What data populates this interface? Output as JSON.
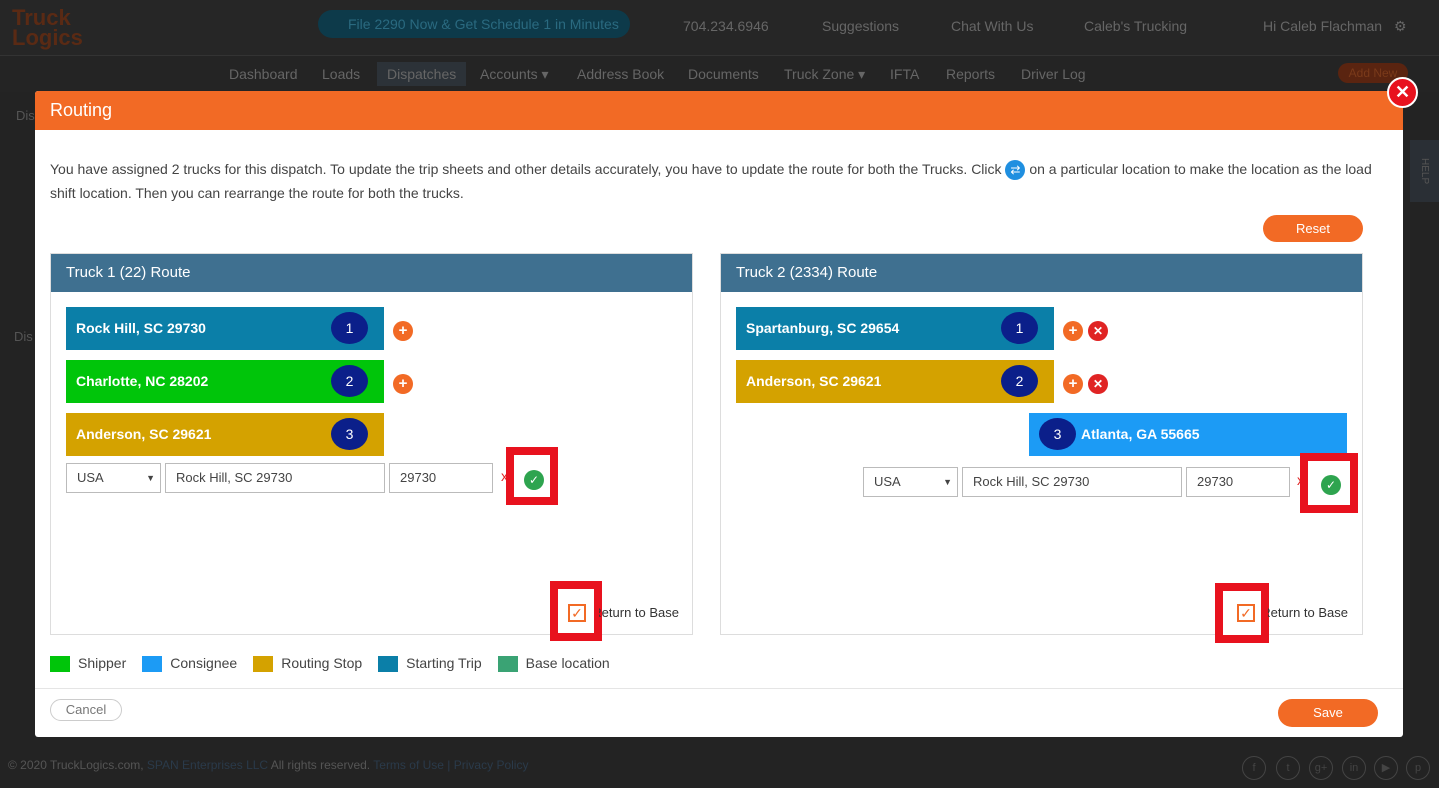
{
  "header": {
    "logo": "Truck Logics",
    "promo": "File 2290 Now & Get Schedule 1 in Minutes",
    "phone": "704.234.6946",
    "suggestions": "Suggestions",
    "chat": "Chat With Us",
    "company": "Caleb's Trucking",
    "user": "Hi Caleb Flachman"
  },
  "nav": {
    "items": [
      "Dashboard",
      "Loads",
      "Dispatches",
      "Accounts ▾",
      "Address Book",
      "Documents",
      "Truck Zone ▾",
      "IFTA",
      "Reports",
      "Driver Log"
    ],
    "add_new": "Add New"
  },
  "sidebar": {
    "top": "Dis",
    "bottom": "Dis"
  },
  "help": "HELP",
  "footer": {
    "copyright": "© 2020 TruckLogics.com,",
    "company": "SPAN Enterprises LLC",
    "rights": "All rights reserved.",
    "terms": "Terms of Use",
    "sep": "|",
    "privacy": "Privacy Policy"
  },
  "modal": {
    "title": "Routing",
    "intro_before": "You have assigned 2 trucks for this dispatch. To update the trip sheets and other details accurately, you have to update the route for both the Trucks. Click",
    "intro_after": "on a particular location to make the location as the load shift location. Then you can rearrange the route for both the trucks.",
    "reset": "Reset",
    "truck1": {
      "title": "Truck 1 (22) Route",
      "stops": [
        {
          "label": "Rock Hill, SC 29730",
          "num": "1",
          "type": "Starting Trip"
        },
        {
          "label": "Charlotte, NC 28202",
          "num": "2",
          "type": "Shipper"
        },
        {
          "label": "Anderson, SC 29621",
          "num": "3",
          "type": "Routing Stop"
        }
      ],
      "country": "USA",
      "address": "Rock Hill, SC 29730",
      "zip": "29730",
      "return_to_base": "Return to Base",
      "return_checked": true
    },
    "truck2": {
      "title": "Truck 2 (2334) Route",
      "stops": [
        {
          "label": "Spartanburg, SC 29654",
          "num": "1",
          "type": "Starting Trip"
        },
        {
          "label": "Anderson, SC 29621",
          "num": "2",
          "type": "Routing Stop"
        },
        {
          "label": "Atlanta, GA 55665",
          "num": "3",
          "type": "Consignee"
        }
      ],
      "country": "USA",
      "address": "Rock Hill, SC 29730",
      "zip": "29730",
      "return_to_base": "Return to Base",
      "return_checked": true
    },
    "legend": [
      {
        "label": "Shipper",
        "color": "#00c50a"
      },
      {
        "label": "Consignee",
        "color": "#1c9bf5"
      },
      {
        "label": "Routing Stop",
        "color": "#d4a200"
      },
      {
        "label": "Starting Trip",
        "color": "#0b7fa8"
      },
      {
        "label": "Base location",
        "color": "#3aa374"
      }
    ],
    "cancel": "Cancel",
    "save": "Save"
  },
  "colors": {
    "accent": "#f26a25",
    "panel_header": "#3f7090",
    "highlight": "#e8121e"
  }
}
